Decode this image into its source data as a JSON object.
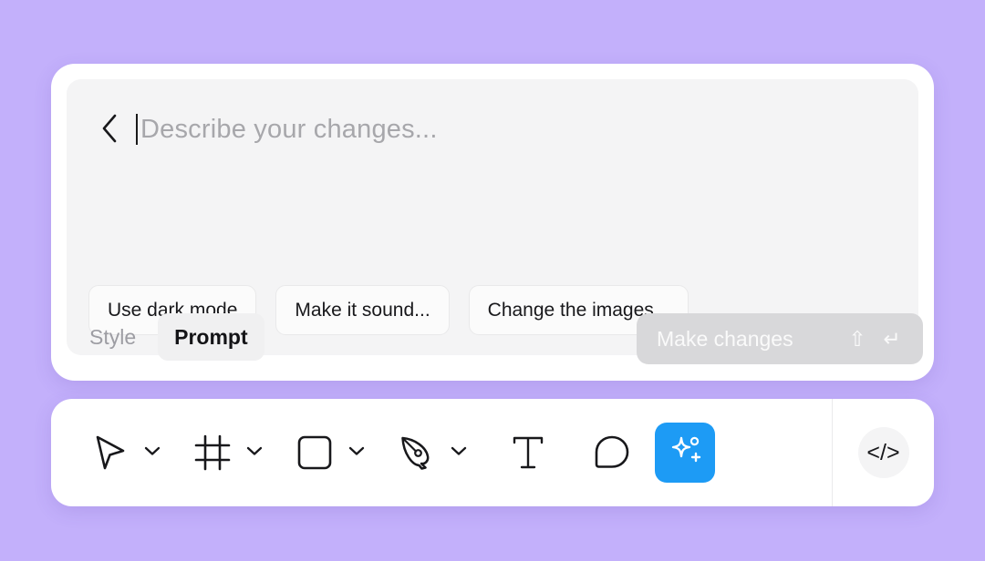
{
  "theme": {
    "background": "#c3b0fb",
    "card_background": "#ffffff",
    "panel_background": "#f4f4f5",
    "accent_blue": "#1d9bf5",
    "text_primary": "#18181b",
    "text_muted": "#a7a7ab",
    "disabled_button": "#d8d8da"
  },
  "prompt_panel": {
    "back_button_label": "Back",
    "back_icon": "chevron-left-icon",
    "input": {
      "value": "",
      "placeholder": "Describe your changes...",
      "caret_visible": true
    },
    "suggestions": [
      {
        "label": "Use dark mode"
      },
      {
        "label": "Make it sound..."
      },
      {
        "label": "Change the images..."
      }
    ],
    "tabs": [
      {
        "label": "Style",
        "active": false
      },
      {
        "label": "Prompt",
        "active": true
      }
    ],
    "submit": {
      "label": "Make changes",
      "enabled": false,
      "shortcut_shift": "⇧",
      "shortcut_enter": "↵",
      "shift_icon": "shift-key-icon",
      "enter_icon": "enter-key-icon"
    }
  },
  "toolbar": {
    "tools": [
      {
        "name": "move-tool",
        "icon": "cursor-arrow-icon",
        "label": "Move",
        "has_dropdown": true,
        "active": false
      },
      {
        "name": "frame-tool",
        "icon": "frame-icon",
        "label": "Frame",
        "has_dropdown": true,
        "active": false
      },
      {
        "name": "shape-tool",
        "icon": "square-icon",
        "label": "Rectangle",
        "has_dropdown": true,
        "active": false
      },
      {
        "name": "pen-tool",
        "icon": "pen-nib-icon",
        "label": "Pen",
        "has_dropdown": true,
        "active": false
      },
      {
        "name": "text-tool",
        "icon": "text-t-icon",
        "label": "Text",
        "has_dropdown": false,
        "active": false
      },
      {
        "name": "comment-tool",
        "icon": "comment-bubble-icon",
        "label": "Comment",
        "has_dropdown": false,
        "active": false
      },
      {
        "name": "ai-tool",
        "icon": "sparkle-plus-icon",
        "label": "AI",
        "has_dropdown": false,
        "active": true
      }
    ],
    "dropdown_icon": "chevron-down-icon",
    "code_button": {
      "label": "</>",
      "icon": "code-brackets-icon",
      "name": "dev-mode-button"
    }
  }
}
